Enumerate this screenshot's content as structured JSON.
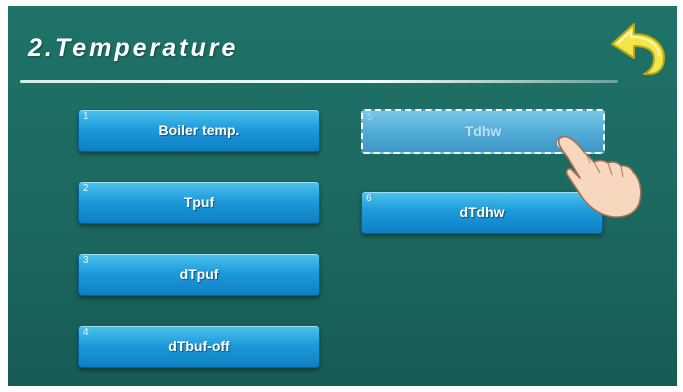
{
  "header": {
    "title": "2.Temperature"
  },
  "menu": {
    "left": [
      {
        "num": "1",
        "label": "Boiler temp."
      },
      {
        "num": "2",
        "label": "Tpuf"
      },
      {
        "num": "3",
        "label": "dTpuf"
      },
      {
        "num": "4",
        "label": "dTbuf-off"
      }
    ],
    "right": [
      {
        "num": "5",
        "label": "Tdhw",
        "state": "disabled"
      },
      {
        "num": "6",
        "label": "dTdhw"
      }
    ]
  },
  "colors": {
    "background": "#1c6b62",
    "button": "#1e9bdb",
    "back_arrow": "#f2e64a"
  },
  "icons": {
    "back": "back-arrow-icon",
    "hand": "pointing-hand-icon"
  }
}
